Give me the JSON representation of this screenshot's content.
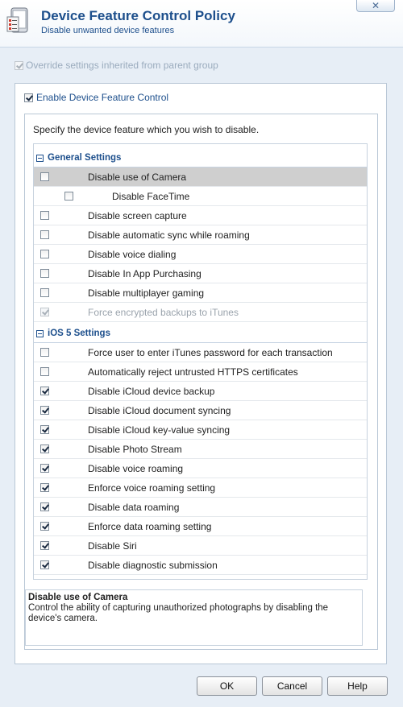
{
  "header": {
    "title": "Device Feature Control Policy",
    "subtitle": "Disable unwanted device features",
    "close_label": "✕",
    "icon": "policy-list-icon"
  },
  "override": {
    "label": "Override settings inherited from parent group",
    "checked": true,
    "disabled": true
  },
  "enable": {
    "label": "Enable Device Feature Control",
    "checked": true
  },
  "instruction": "Specify the device feature which you wish to disable.",
  "sections": [
    {
      "title": "General Settings",
      "items": [
        {
          "label": "Disable use of Camera",
          "checked": false,
          "selected": true
        },
        {
          "label": "Disable FaceTime",
          "checked": false,
          "indent": true
        },
        {
          "label": "Disable screen capture",
          "checked": false
        },
        {
          "label": "Disable automatic sync while roaming",
          "checked": false
        },
        {
          "label": "Disable voice dialing",
          "checked": false
        },
        {
          "label": "Disable In App Purchasing",
          "checked": false
        },
        {
          "label": "Disable multiplayer gaming",
          "checked": false
        },
        {
          "label": "Force encrypted backups to iTunes",
          "checked": true,
          "disabled": true
        }
      ]
    },
    {
      "title": "iOS 5 Settings",
      "items": [
        {
          "label": "Force user to enter iTunes password for each transaction",
          "checked": false
        },
        {
          "label": "Automatically reject untrusted HTTPS certificates",
          "checked": false
        },
        {
          "label": "Disable iCloud device backup",
          "checked": true
        },
        {
          "label": "Disable iCloud document syncing",
          "checked": true
        },
        {
          "label": "Disable iCloud key-value syncing",
          "checked": true
        },
        {
          "label": "Disable Photo Stream",
          "checked": true
        },
        {
          "label": "Disable voice roaming",
          "checked": true
        },
        {
          "label": "Enforce voice roaming setting",
          "checked": true
        },
        {
          "label": "Disable data roaming",
          "checked": true
        },
        {
          "label": "Enforce data roaming setting",
          "checked": true
        },
        {
          "label": "Disable Siri",
          "checked": true
        },
        {
          "label": "Disable diagnostic submission",
          "checked": true
        }
      ]
    }
  ],
  "description": {
    "title": "Disable use of Camera",
    "text": "Control the ability of capturing unauthorized photographs by disabling the device's camera."
  },
  "buttons": {
    "ok": "OK",
    "cancel": "Cancel",
    "help": "Help"
  },
  "colors": {
    "accent": "#1d4f8c",
    "selected_row": "#cfcfcf",
    "background": "#e7eef6"
  }
}
